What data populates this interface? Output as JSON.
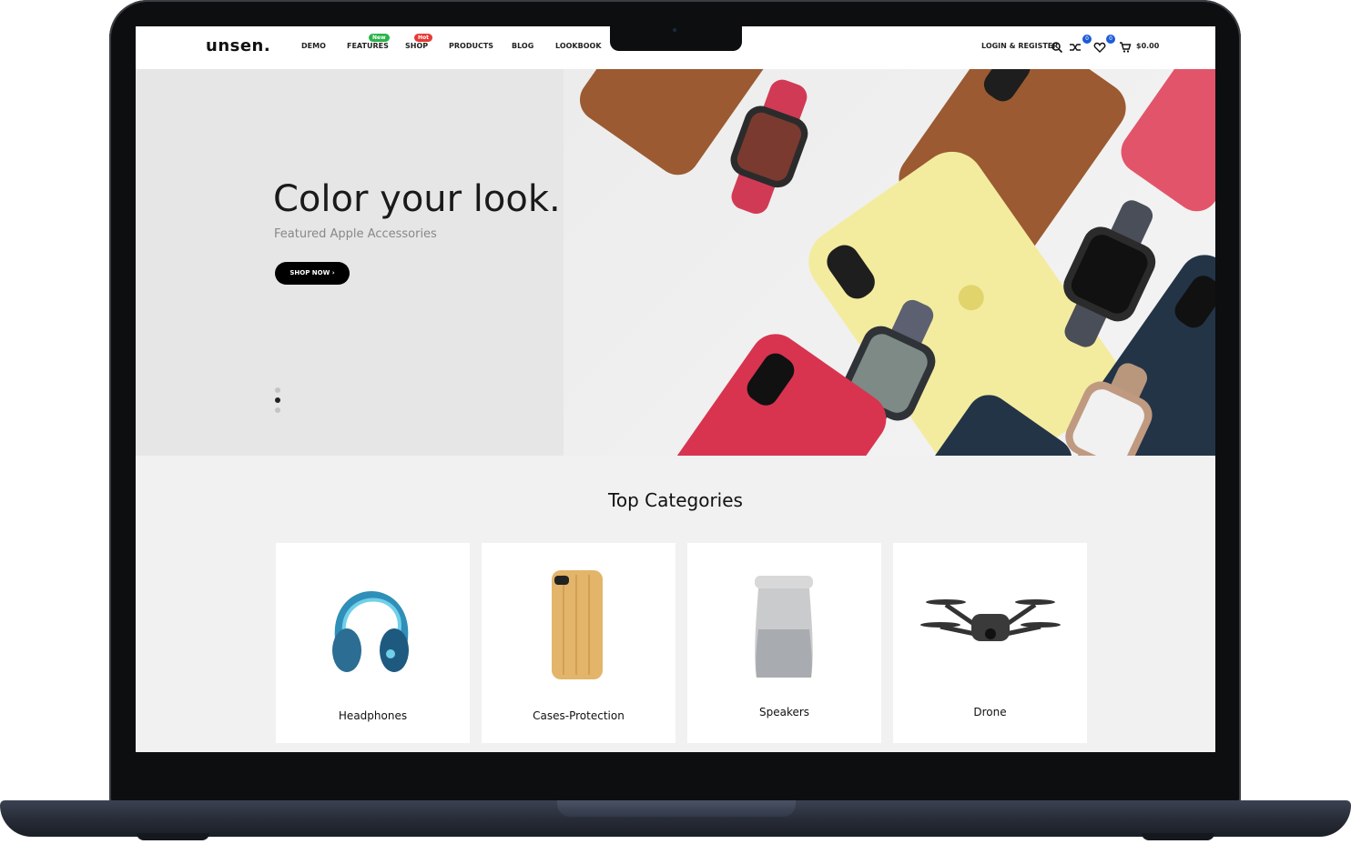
{
  "brand": "unsen.",
  "nav": [
    {
      "label": "DEMO"
    },
    {
      "label": "FEATURES",
      "badge": "New",
      "badge_color": "#2bb34a"
    },
    {
      "label": "SHOP",
      "badge": "Hot",
      "badge_color": "#e53935"
    },
    {
      "label": "PRODUCTS"
    },
    {
      "label": "BLOG"
    },
    {
      "label": "LOOKBOOK"
    }
  ],
  "header": {
    "login_label": "LOGIN & REGISTER",
    "compare_count": "0",
    "wishlist_count": "0",
    "cart_total": "$0.00",
    "icons": [
      "search-icon",
      "compare-icon",
      "heart-icon",
      "cart-icon"
    ]
  },
  "hero": {
    "title": "Color your look.",
    "subtitle": "Featured Apple Accessories",
    "cta_label": "SHOP NOW ›",
    "slides": 3,
    "active_slide": 2
  },
  "categories": {
    "title": "Top Categories",
    "items": [
      {
        "label": "Headphones",
        "icon": "headphones-image"
      },
      {
        "label": "Cases-Protection",
        "icon": "phone-case-image"
      },
      {
        "label": "Speakers",
        "icon": "speaker-image"
      },
      {
        "label": "Drone",
        "icon": "drone-image"
      }
    ]
  },
  "colors": {
    "accent": "#1c5bd8",
    "badge_new": "#2bb34a",
    "badge_hot": "#e53935",
    "hero_bg": "#e6e6e6",
    "button": "#000000"
  }
}
